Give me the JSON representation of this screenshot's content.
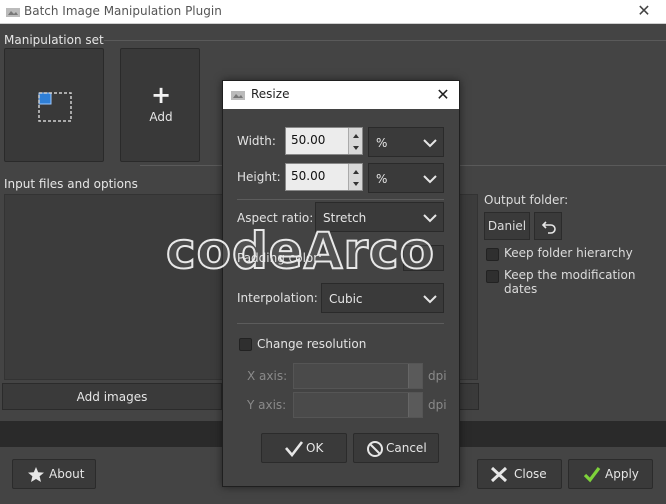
{
  "window": {
    "title": "Batch Image Manipulation Plugin"
  },
  "sections": {
    "manipulation_set": "Manipulation set",
    "input_files": "Input files and options"
  },
  "manipulation": {
    "add_label": "Add"
  },
  "input": {
    "add_images_label": "Add images"
  },
  "output": {
    "folder_label": "Output folder:",
    "folder_button": "Daniel",
    "keep_hierarchy": "Keep folder hierarchy",
    "keep_dates": "Keep the modification dates"
  },
  "buttons": {
    "about": "About",
    "close": "Close",
    "apply": "Apply"
  },
  "resize_dialog": {
    "title": "Resize",
    "width_label": "Width:",
    "width_value": "50.00",
    "width_unit": "%",
    "height_label": "Height:",
    "height_value": "50.00",
    "height_unit": "%",
    "aspect_label": "Aspect ratio:",
    "aspect_value": "Stretch",
    "padding_label": "Padding color:",
    "interp_label": "Interpolation:",
    "interp_value": "Cubic",
    "change_res_label": "Change resolution",
    "xaxis_label": "X axis:",
    "yaxis_label": "Y axis:",
    "dpi_unit": "dpi",
    "ok_label": "OK",
    "cancel_label": "Cancel"
  },
  "watermark": "codeArco",
  "colors": {
    "accent_check": "#7ed23a",
    "star": "#e6e6e6",
    "selection_blue": "#2f7fd6"
  }
}
